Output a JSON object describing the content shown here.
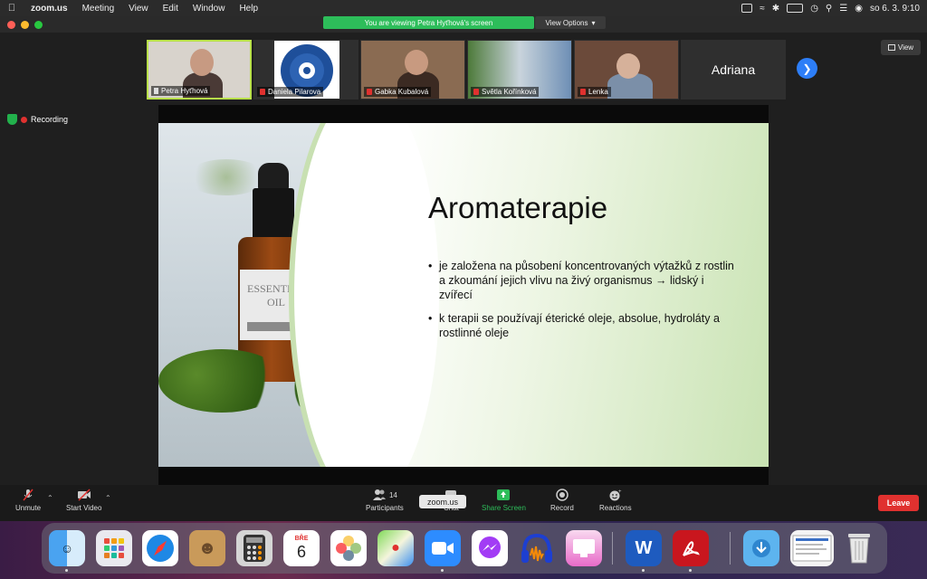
{
  "menubar": {
    "app_name": "zoom.us",
    "menus": [
      "Meeting",
      "View",
      "Edit",
      "Window",
      "Help"
    ],
    "clock": "so 6. 3.  9:10"
  },
  "share_banner": {
    "text": "You are viewing Petra Hyťhová's screen",
    "view_options_label": "View Options"
  },
  "participants": [
    {
      "name": "Petra Hyťhová",
      "active": true,
      "muted": false,
      "pinned": true
    },
    {
      "name": "Daniela Pilarova",
      "active": false,
      "muted": true
    },
    {
      "name": "Gabka Kubalová",
      "active": false,
      "muted": true
    },
    {
      "name": "Světla Kořínková",
      "active": false,
      "muted": true
    },
    {
      "name": "Lenka",
      "active": false,
      "muted": true
    },
    {
      "name": "Adriana",
      "active": false,
      "muted": false,
      "video_off": true
    }
  ],
  "view_button_label": "View",
  "recording_label": "Recording",
  "slide": {
    "title": "Aromaterapie",
    "bottle_label_line1": "ESSENTIAL",
    "bottle_label_line2": "OIL",
    "bullets": [
      "je založena na působení koncentrovaných výtažků z rostlin a zkoumání jejich vlivu na živý organismus → lidský i zvířecí",
      "k terapii se používají éterické oleje, absolue, hydroláty a rostlinné oleje"
    ]
  },
  "toolbar": {
    "unmute_label": "Unmute",
    "start_video_label": "Start Video",
    "participants_label": "Participants",
    "participants_count": "14",
    "chat_label": "Chat",
    "share_screen_label": "Share Screen",
    "record_label": "Record",
    "reactions_label": "Reactions",
    "leave_label": "Leave",
    "tooltip_text": "zoom.us"
  },
  "dock": {
    "calendar_month": "BŘE",
    "calendar_day": "6"
  },
  "colors": {
    "share_green": "#2dbd5a",
    "leave_red": "#e0312f",
    "active_border": "#b8e04a",
    "next_blue": "#2d7ef7"
  }
}
